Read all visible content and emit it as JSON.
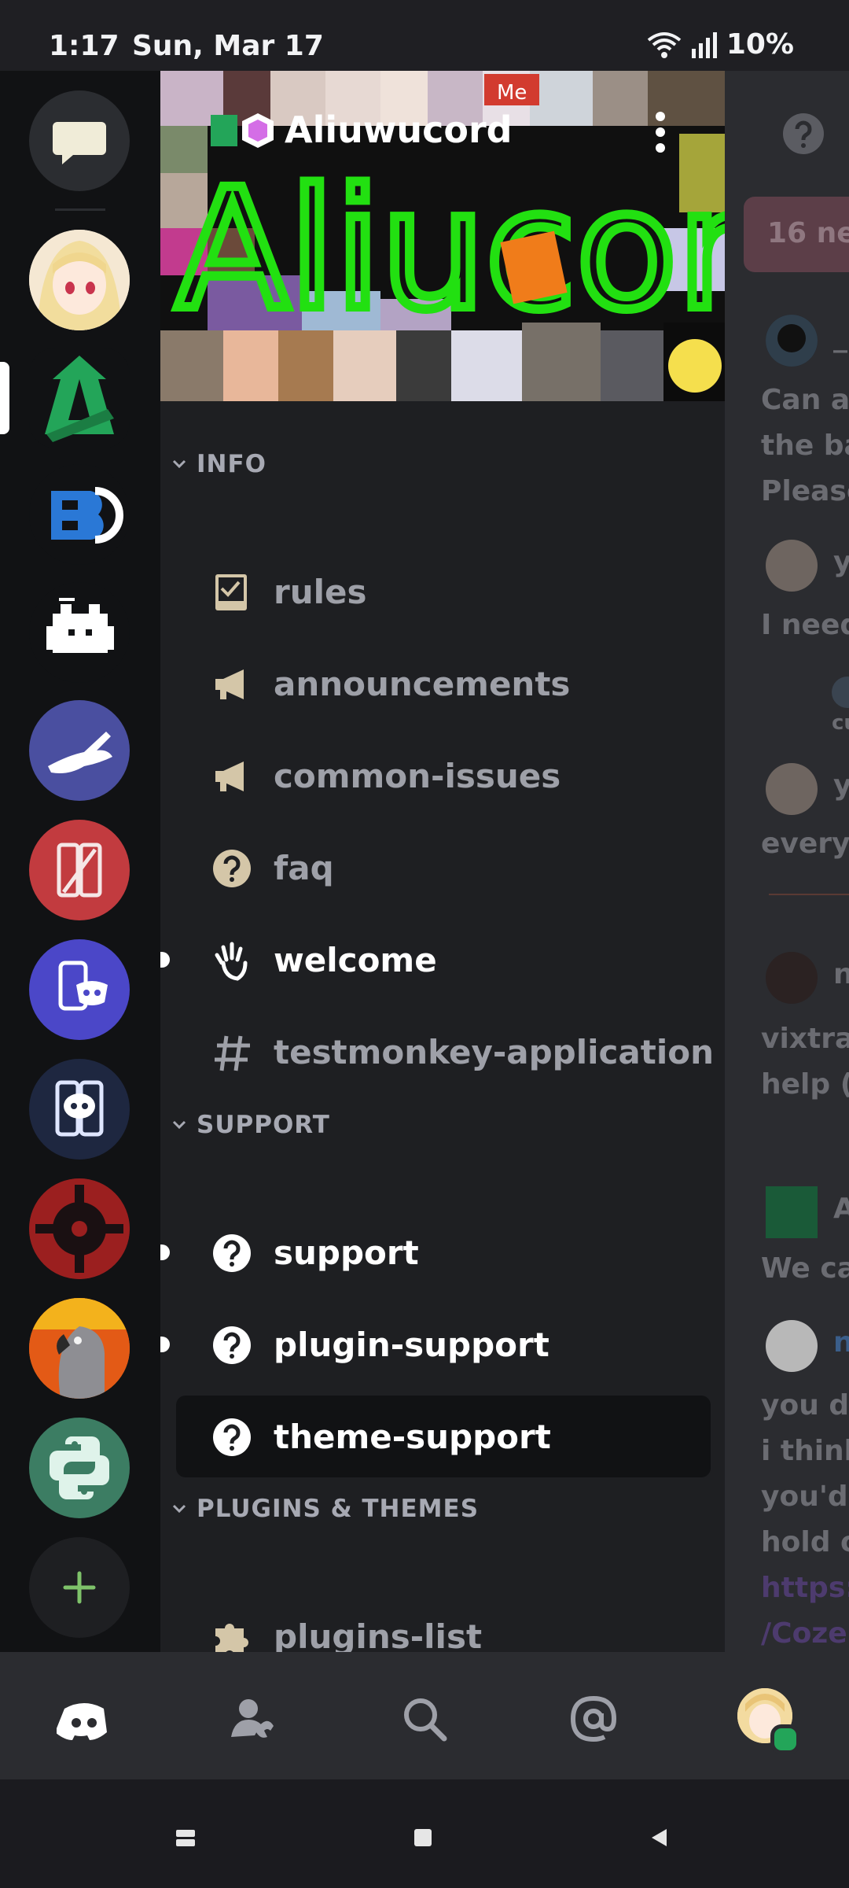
{
  "status_bar": {
    "time": "1:17",
    "date": "Sun, Mar 17",
    "battery": "10%"
  },
  "server": {
    "name": "Aliuwucord",
    "banner_text": "Aliucord",
    "banner_stamp": "Me"
  },
  "categories": {
    "info": "INFO",
    "support": "SUPPORT",
    "plugins_themes": "PLUGINS & THEMES"
  },
  "channels": {
    "rules": "rules",
    "announcements": "announcements",
    "common_issues": "common-issues",
    "faq": "faq",
    "welcome": "welcome",
    "testmonkey": "testmonkey-application",
    "support": "support",
    "plugin_support": "plugin-support",
    "theme_support": "theme-support",
    "plugins_list": "plugins-list"
  },
  "chat_peek": {
    "new_bar": "16 ne",
    "lines": [
      "Can ar",
      "the ba",
      "Please",
      "I need",
      "every",
      "vixtra",
      "help (i",
      "We ca",
      "you di",
      "i think",
      "you'd",
      "hold o"
    ],
    "names": [
      "_",
      "y",
      "y",
      "n",
      "A",
      "n"
    ],
    "small": "cu",
    "links": [
      "https:/",
      "/Coze"
    ]
  },
  "icons": {
    "tabs": [
      "discord-home-icon",
      "friends-icon",
      "search-icon",
      "mentions-icon",
      "profile-avatar"
    ],
    "nav": [
      "recents-icon",
      "home-icon",
      "back-icon"
    ]
  },
  "colors": {
    "accent_green": "#23a559",
    "banner_green": "#22e011",
    "orange": "#f07c1a",
    "selected_bg": "#111214"
  }
}
